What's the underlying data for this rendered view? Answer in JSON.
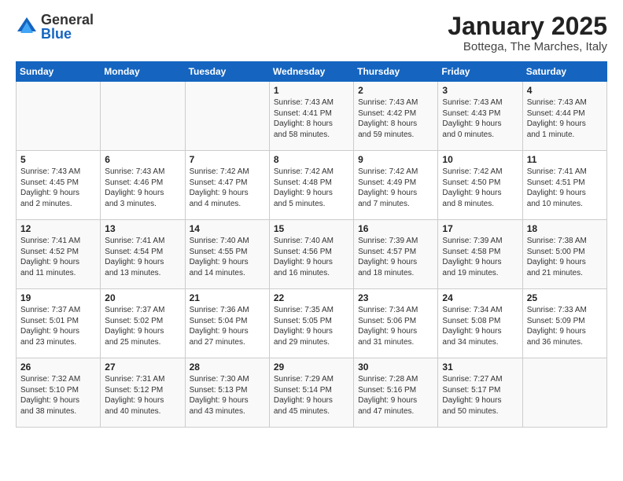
{
  "logo": {
    "general": "General",
    "blue": "Blue"
  },
  "header": {
    "month": "January 2025",
    "location": "Bottega, The Marches, Italy"
  },
  "days_header": [
    "Sunday",
    "Monday",
    "Tuesday",
    "Wednesday",
    "Thursday",
    "Friday",
    "Saturday"
  ],
  "weeks": [
    [
      {
        "day": "",
        "content": ""
      },
      {
        "day": "",
        "content": ""
      },
      {
        "day": "",
        "content": ""
      },
      {
        "day": "1",
        "content": "Sunrise: 7:43 AM\nSunset: 4:41 PM\nDaylight: 8 hours\nand 58 minutes."
      },
      {
        "day": "2",
        "content": "Sunrise: 7:43 AM\nSunset: 4:42 PM\nDaylight: 8 hours\nand 59 minutes."
      },
      {
        "day": "3",
        "content": "Sunrise: 7:43 AM\nSunset: 4:43 PM\nDaylight: 9 hours\nand 0 minutes."
      },
      {
        "day": "4",
        "content": "Sunrise: 7:43 AM\nSunset: 4:44 PM\nDaylight: 9 hours\nand 1 minute."
      }
    ],
    [
      {
        "day": "5",
        "content": "Sunrise: 7:43 AM\nSunset: 4:45 PM\nDaylight: 9 hours\nand 2 minutes."
      },
      {
        "day": "6",
        "content": "Sunrise: 7:43 AM\nSunset: 4:46 PM\nDaylight: 9 hours\nand 3 minutes."
      },
      {
        "day": "7",
        "content": "Sunrise: 7:42 AM\nSunset: 4:47 PM\nDaylight: 9 hours\nand 4 minutes."
      },
      {
        "day": "8",
        "content": "Sunrise: 7:42 AM\nSunset: 4:48 PM\nDaylight: 9 hours\nand 5 minutes."
      },
      {
        "day": "9",
        "content": "Sunrise: 7:42 AM\nSunset: 4:49 PM\nDaylight: 9 hours\nand 7 minutes."
      },
      {
        "day": "10",
        "content": "Sunrise: 7:42 AM\nSunset: 4:50 PM\nDaylight: 9 hours\nand 8 minutes."
      },
      {
        "day": "11",
        "content": "Sunrise: 7:41 AM\nSunset: 4:51 PM\nDaylight: 9 hours\nand 10 minutes."
      }
    ],
    [
      {
        "day": "12",
        "content": "Sunrise: 7:41 AM\nSunset: 4:52 PM\nDaylight: 9 hours\nand 11 minutes."
      },
      {
        "day": "13",
        "content": "Sunrise: 7:41 AM\nSunset: 4:54 PM\nDaylight: 9 hours\nand 13 minutes."
      },
      {
        "day": "14",
        "content": "Sunrise: 7:40 AM\nSunset: 4:55 PM\nDaylight: 9 hours\nand 14 minutes."
      },
      {
        "day": "15",
        "content": "Sunrise: 7:40 AM\nSunset: 4:56 PM\nDaylight: 9 hours\nand 16 minutes."
      },
      {
        "day": "16",
        "content": "Sunrise: 7:39 AM\nSunset: 4:57 PM\nDaylight: 9 hours\nand 18 minutes."
      },
      {
        "day": "17",
        "content": "Sunrise: 7:39 AM\nSunset: 4:58 PM\nDaylight: 9 hours\nand 19 minutes."
      },
      {
        "day": "18",
        "content": "Sunrise: 7:38 AM\nSunset: 5:00 PM\nDaylight: 9 hours\nand 21 minutes."
      }
    ],
    [
      {
        "day": "19",
        "content": "Sunrise: 7:37 AM\nSunset: 5:01 PM\nDaylight: 9 hours\nand 23 minutes."
      },
      {
        "day": "20",
        "content": "Sunrise: 7:37 AM\nSunset: 5:02 PM\nDaylight: 9 hours\nand 25 minutes."
      },
      {
        "day": "21",
        "content": "Sunrise: 7:36 AM\nSunset: 5:04 PM\nDaylight: 9 hours\nand 27 minutes."
      },
      {
        "day": "22",
        "content": "Sunrise: 7:35 AM\nSunset: 5:05 PM\nDaylight: 9 hours\nand 29 minutes."
      },
      {
        "day": "23",
        "content": "Sunrise: 7:34 AM\nSunset: 5:06 PM\nDaylight: 9 hours\nand 31 minutes."
      },
      {
        "day": "24",
        "content": "Sunrise: 7:34 AM\nSunset: 5:08 PM\nDaylight: 9 hours\nand 34 minutes."
      },
      {
        "day": "25",
        "content": "Sunrise: 7:33 AM\nSunset: 5:09 PM\nDaylight: 9 hours\nand 36 minutes."
      }
    ],
    [
      {
        "day": "26",
        "content": "Sunrise: 7:32 AM\nSunset: 5:10 PM\nDaylight: 9 hours\nand 38 minutes."
      },
      {
        "day": "27",
        "content": "Sunrise: 7:31 AM\nSunset: 5:12 PM\nDaylight: 9 hours\nand 40 minutes."
      },
      {
        "day": "28",
        "content": "Sunrise: 7:30 AM\nSunset: 5:13 PM\nDaylight: 9 hours\nand 43 minutes."
      },
      {
        "day": "29",
        "content": "Sunrise: 7:29 AM\nSunset: 5:14 PM\nDaylight: 9 hours\nand 45 minutes."
      },
      {
        "day": "30",
        "content": "Sunrise: 7:28 AM\nSunset: 5:16 PM\nDaylight: 9 hours\nand 47 minutes."
      },
      {
        "day": "31",
        "content": "Sunrise: 7:27 AM\nSunset: 5:17 PM\nDaylight: 9 hours\nand 50 minutes."
      },
      {
        "day": "",
        "content": ""
      }
    ]
  ]
}
